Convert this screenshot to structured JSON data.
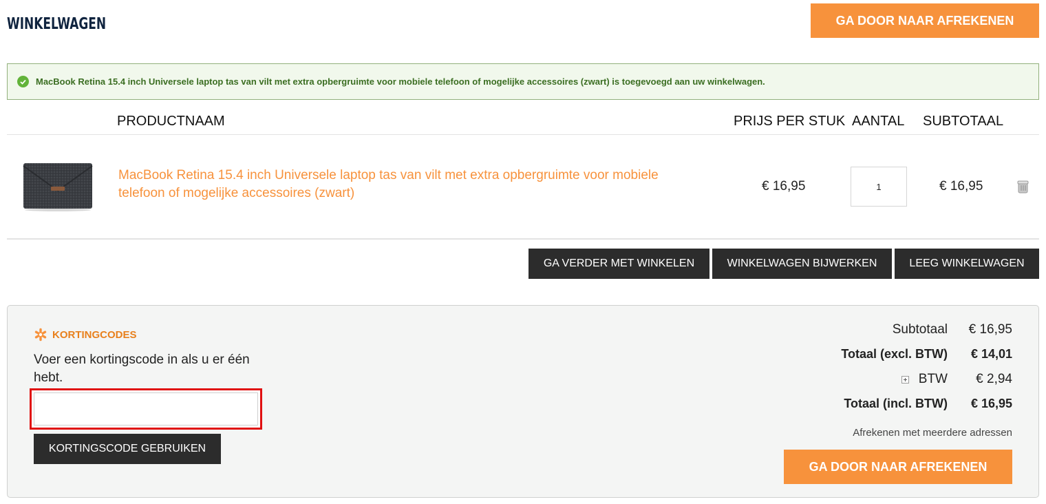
{
  "header": {
    "title": "WINKELWAGEN",
    "checkout_label": "GA DOOR NAAR AFREKENEN"
  },
  "message": {
    "text": "MacBook Retina 15.4 inch Universele laptop tas van vilt met extra opbergruimte voor mobiele telefoon of mogelijke accessoires (zwart) is toegevoegd aan uw winkelwagen."
  },
  "table": {
    "columns": {
      "name": "PRODUCTNAAM",
      "price": "PRIJS PER STUK",
      "qty": "AANTAL",
      "subtotal": "SUBTOTAAL"
    },
    "items": [
      {
        "name": "MacBook Retina 15.4 inch Universele laptop tas van vilt met extra opbergruimte voor mobiele telefoon of mogelijke accessoires (zwart)",
        "price": "€ 16,95",
        "qty": "1",
        "subtotal": "€ 16,95"
      }
    ]
  },
  "actions": {
    "continue": "GA VERDER MET WINKELEN",
    "update": "WINKELWAGEN BIJWERKEN",
    "empty": "LEEG WINKELWAGEN"
  },
  "coupon": {
    "title": "KORTINGCODES",
    "description": "Voer een kortingscode in als u er één hebt.",
    "input_value": "",
    "button": "KORTINGSCODE GEBRUIKEN"
  },
  "totals": {
    "subtotal_label": "Subtotaal",
    "subtotal_value": "€ 16,95",
    "excl_label": "Totaal (excl. BTW)",
    "excl_value": "€ 14,01",
    "btw_label": "BTW",
    "btw_value": "€ 2,94",
    "incl_label": "Totaal (incl. BTW)",
    "incl_value": "€ 16,95",
    "multi_address": "Afrekenen met meerdere adressen",
    "checkout_label": "GA DOOR NAAR AFREKENEN"
  },
  "colors": {
    "accent_orange": "#f7923c",
    "dark_button": "#2c2c2c",
    "title_navy": "#10243f",
    "success_green": "#62b33a",
    "highlight_red": "#e01010"
  }
}
